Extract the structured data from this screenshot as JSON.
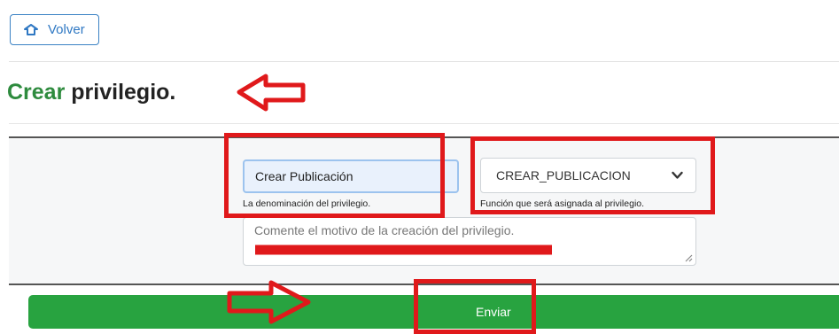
{
  "toolbar": {
    "back_label": "Volver",
    "back_icon": "back-arrow-icon"
  },
  "header": {
    "title_accent": "Crear",
    "title_rest": "privilegio."
  },
  "form": {
    "name_value": "Crear Publicación",
    "name_help": "La denominación del privilegio.",
    "function_selected": "CREAR_PUBLICACION",
    "function_help": "Función que será asignada al privilegio.",
    "reason_placeholder": "Comente el motivo de la creación del privilegio.",
    "submit_label": "Enviar"
  },
  "colors": {
    "accent_green": "#2e8b3e",
    "button_green": "#28a340",
    "link_blue": "#2f78c3",
    "annotation_red": "#e0191b"
  }
}
